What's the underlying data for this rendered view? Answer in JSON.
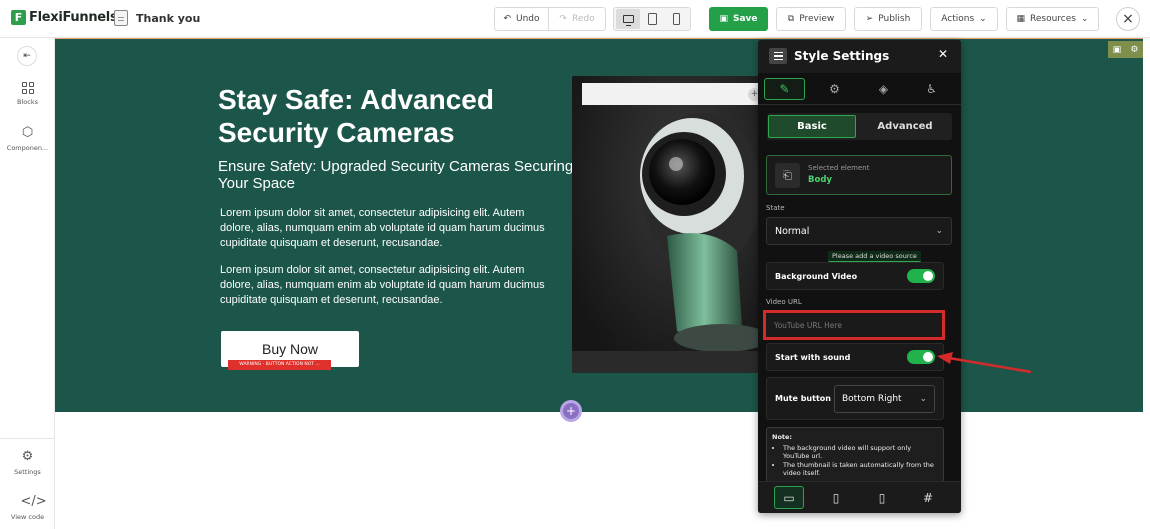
{
  "header": {
    "logo_text": "FlexiFunnels",
    "logo_mark": "F",
    "page_name": "Thank you",
    "undo_label": "Undo",
    "redo_label": "Redo",
    "save_label": "Save",
    "preview_label": "Preview",
    "publish_label": "Publish",
    "actions_label": "Actions",
    "resources_label": "Resources",
    "active_device": "desktop"
  },
  "sidebar": {
    "collapse_glyph": "⇤",
    "items": [
      {
        "label": "Blocks",
        "icon": "blocks-grid-icon"
      },
      {
        "label": "Componen...",
        "icon": "cube-icon"
      },
      {
        "label": "Settings",
        "icon": "gear-icon"
      },
      {
        "label": "View code",
        "icon": "code-icon"
      }
    ]
  },
  "hero": {
    "title": "Stay Safe: Advanced Security Cameras",
    "subtitle": "Ensure Safety: Upgraded Security Cameras Securing Your Space",
    "paragraph1": "Lorem ipsum dolor sit amet, consectetur adipisicing elit. Autem dolore, alias, numquam enim ab voluptate id quam harum ducimus cupiditate quisquam et deserunt, recusandae.",
    "paragraph2": "Lorem ipsum dolor sit amet, consectetur adipisicing elit. Autem dolore, alias, numquam enim ab voluptate id quam harum ducimus cupiditate quisquam et deserunt, recusandae.",
    "button_label": "Buy Now",
    "warning_text": "WARNING - BUTTON ACTION NOT ...",
    "background_color": "#1c564a",
    "image_subject": "security-camera-image"
  },
  "style_panel": {
    "title": "Style Settings",
    "tabs": [
      "brush-icon",
      "gear-icon",
      "layers-icon",
      "accessibility-icon"
    ],
    "active_tab": "brush-icon",
    "mode_basic": "Basic",
    "mode_advanced": "Advanced",
    "selected_label": "Selected element",
    "selected_value": "Body",
    "state_label": "State",
    "state_value": "Normal",
    "tooltip": "Please add a video source",
    "bg_video_label": "Background Video",
    "bg_video_on": true,
    "video_url_label": "Video URL",
    "video_url_placeholder": "YouTube URL Here",
    "sound_label": "Start with sound",
    "sound_on": true,
    "mute_label": "Mute button",
    "mute_value": "Bottom Right",
    "note_title": "Note:",
    "note_items": [
      "The background video will support only YouTube url.",
      "The thumbnail is taken automatically from the video itself."
    ],
    "footer_tabs": [
      "desktop-icon",
      "tablet-icon",
      "mobile-icon",
      "hash-icon"
    ],
    "accent_color": "#24a148",
    "highlight_color": "#d42a2a"
  }
}
